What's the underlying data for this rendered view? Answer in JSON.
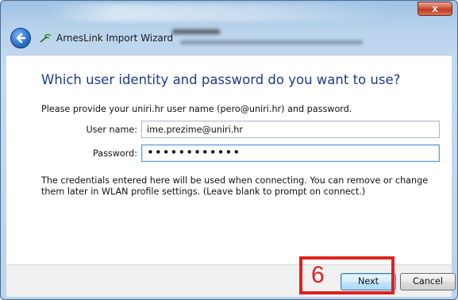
{
  "window": {
    "close_label": "x",
    "app_title": "ArnesLink Import Wizard"
  },
  "content": {
    "heading": "Which user identity and password do you want to use?",
    "instruction": "Please provide your uniri.hr user name (pero@uniri.hr) and password.",
    "username_label": "User name:",
    "username_value": "ime.prezime@uniri.hr",
    "password_label": "Password:",
    "password_value": "••••••••••••",
    "description": "The credentials entered here will be used when connecting. You can remove or change them later in WLAN profile settings. (Leave blank to prompt on connect.)"
  },
  "footer": {
    "next_label": "Next",
    "cancel_label": "Cancel"
  },
  "annotation": {
    "step_number": "6",
    "color": "#e02020"
  },
  "icons": {
    "back": "back-arrow-icon",
    "app": "antenna-icon"
  }
}
